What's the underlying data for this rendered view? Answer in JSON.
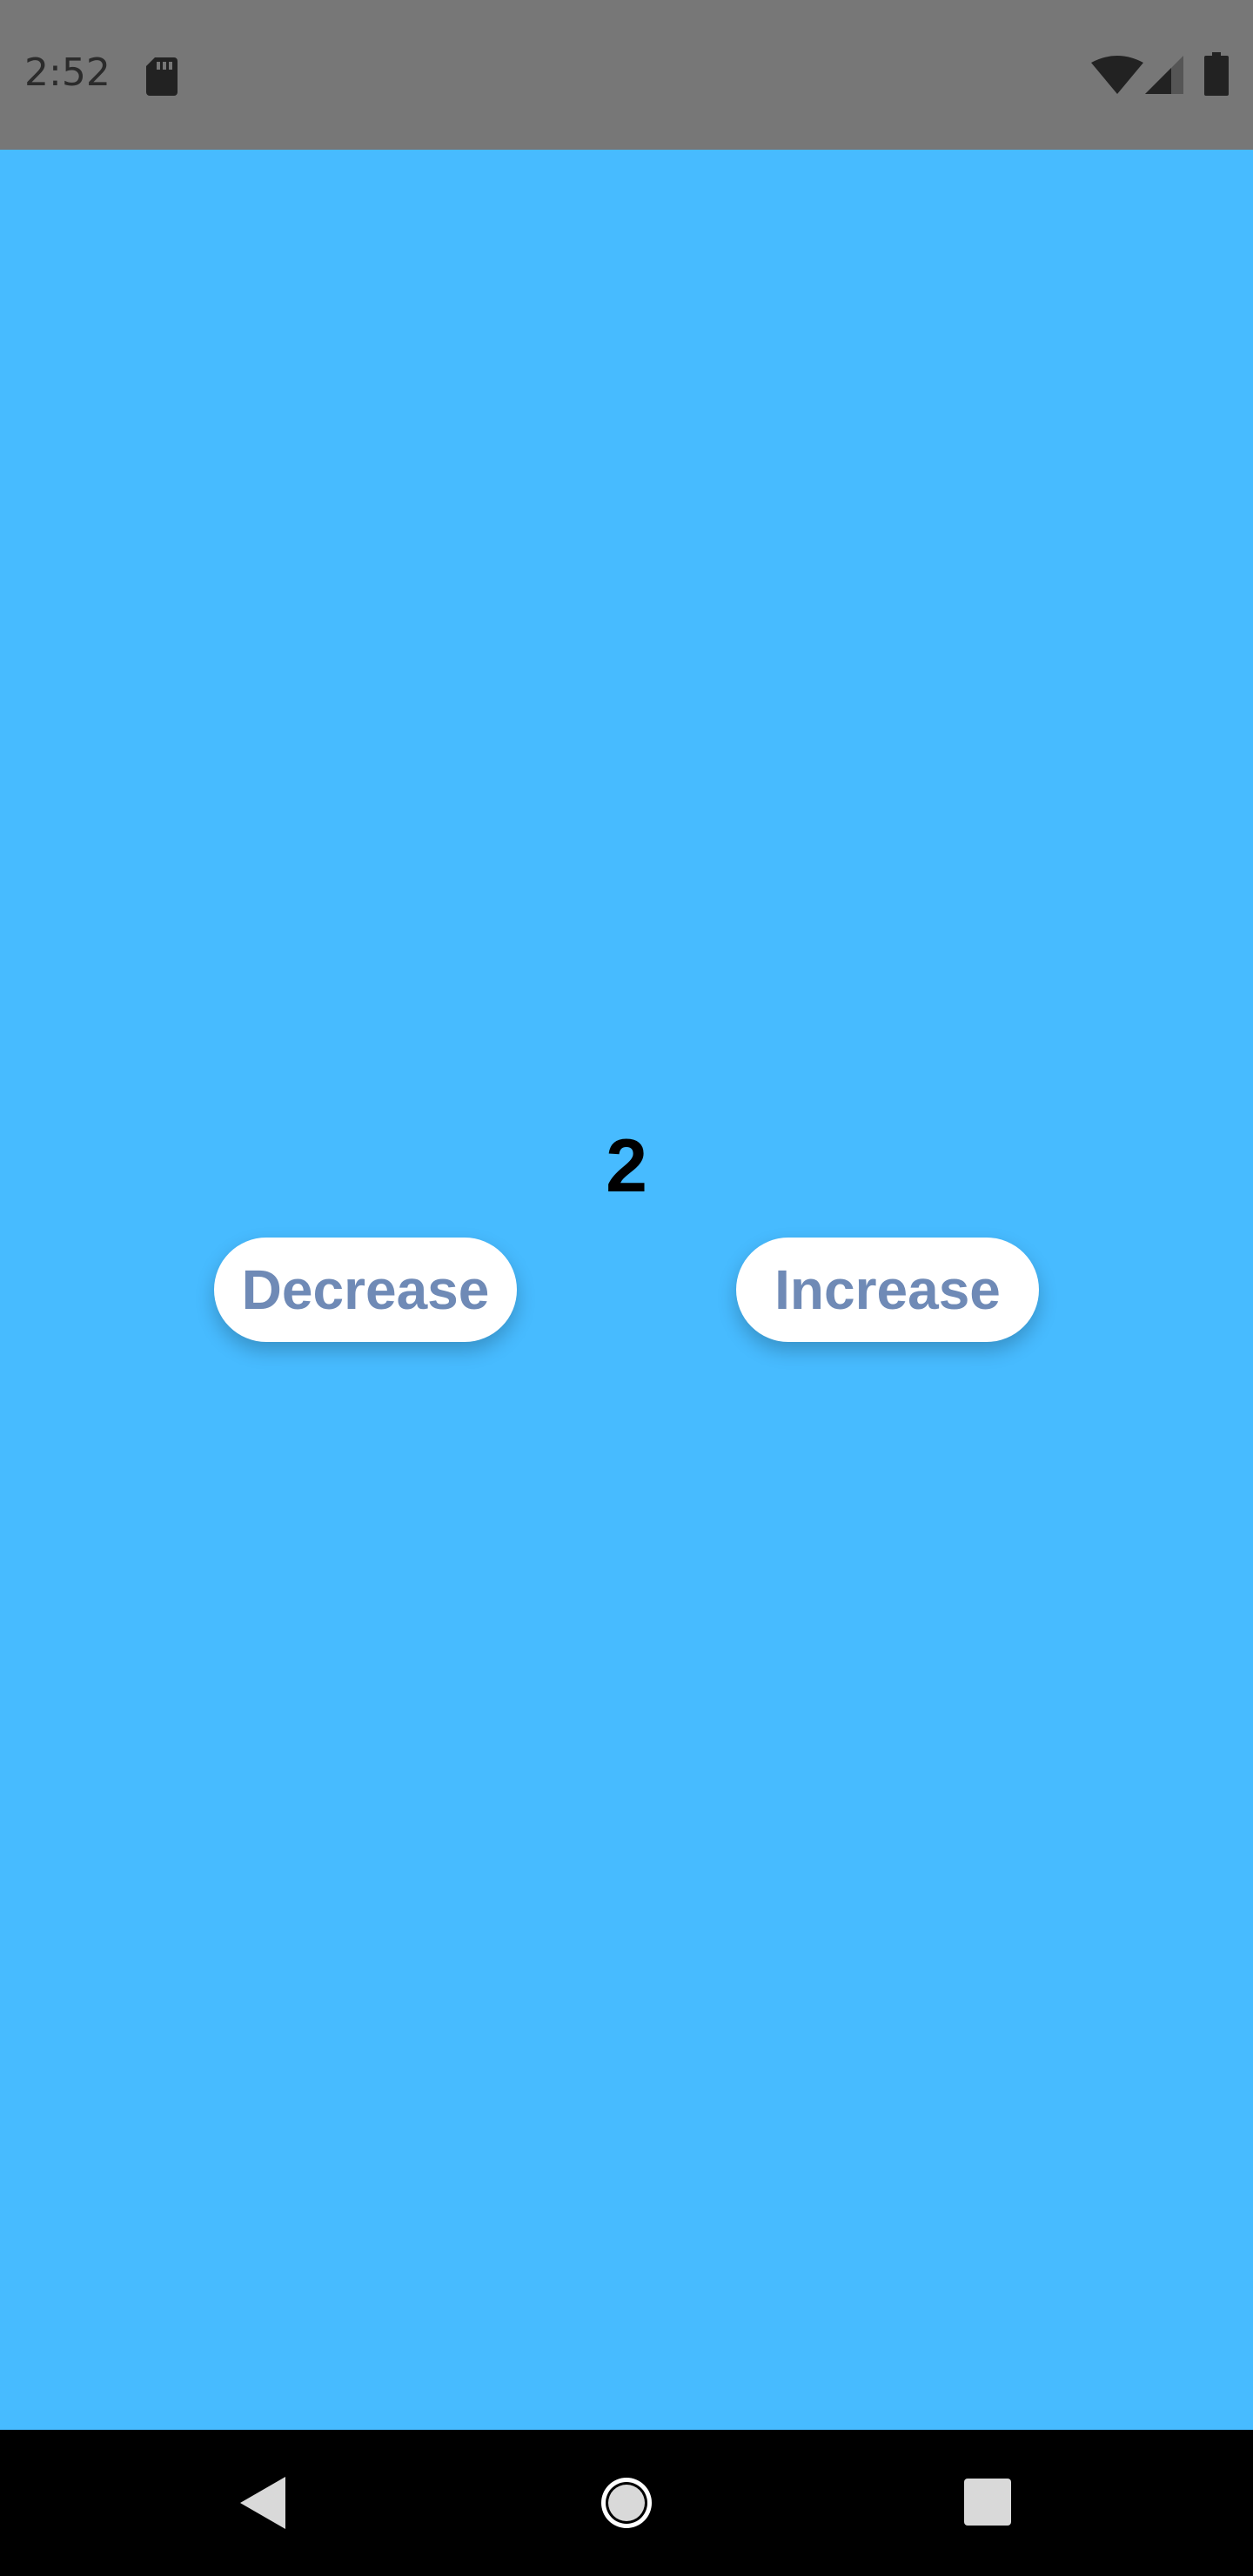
{
  "status_bar": {
    "time": "2:52",
    "icons": [
      "sd-card-icon",
      "wifi-icon",
      "signal-icon",
      "battery-icon"
    ]
  },
  "app": {
    "background_color": "#47bbff",
    "counter_value": "2",
    "decrease_label": "Decrease",
    "increase_label": "Increase",
    "button_text_color": "#6f8ab6"
  },
  "nav_bar": {
    "icons": [
      "back-icon",
      "home-icon",
      "recents-icon"
    ]
  }
}
